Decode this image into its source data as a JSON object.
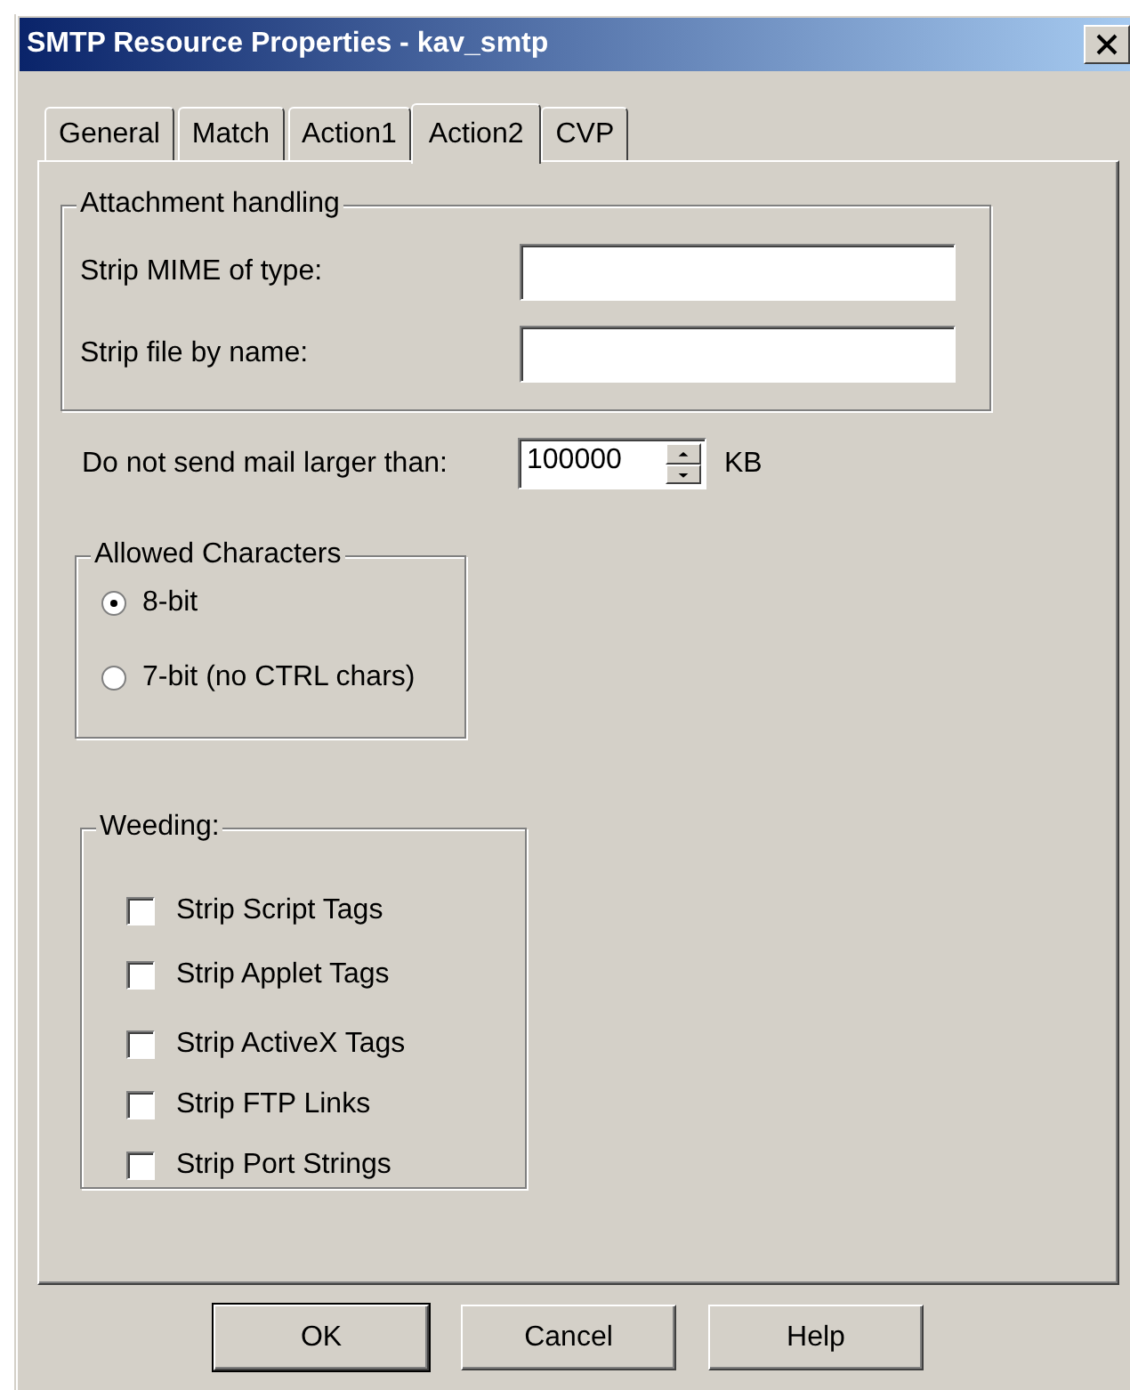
{
  "window": {
    "title": "SMTP Resource Properties - kav_smtp"
  },
  "tabs": [
    {
      "label": "General",
      "selected": false
    },
    {
      "label": "Match",
      "selected": false
    },
    {
      "label": "Action1",
      "selected": false
    },
    {
      "label": "Action2",
      "selected": true
    },
    {
      "label": "CVP",
      "selected": false
    }
  ],
  "attachment_handling": {
    "title": "Attachment handling",
    "fields": [
      {
        "label": "Strip MIME of type:"
      },
      {
        "label": "Strip file by name:"
      }
    ]
  },
  "max_size": {
    "label": "Do not send mail larger than:",
    "value": "100000",
    "unit": "KB"
  },
  "allowed_characters": {
    "title": "Allowed Characters",
    "options": [
      {
        "label": "8-bit",
        "selected": true
      },
      {
        "label": "7-bit (no CTRL chars)",
        "selected": false
      }
    ]
  },
  "weeding": {
    "title": "Weeding:",
    "options": [
      {
        "label": "Strip Script Tags",
        "checked": false
      },
      {
        "label": "Strip Applet Tags",
        "checked": false
      },
      {
        "label": "Strip ActiveX Tags",
        "checked": false
      },
      {
        "label": "Strip FTP Links",
        "checked": false
      },
      {
        "label": "Strip Port Strings",
        "checked": false
      }
    ]
  },
  "buttons": [
    {
      "label": "OK",
      "default": true
    },
    {
      "label": "Cancel",
      "default": false
    },
    {
      "label": "Help",
      "default": false
    }
  ]
}
